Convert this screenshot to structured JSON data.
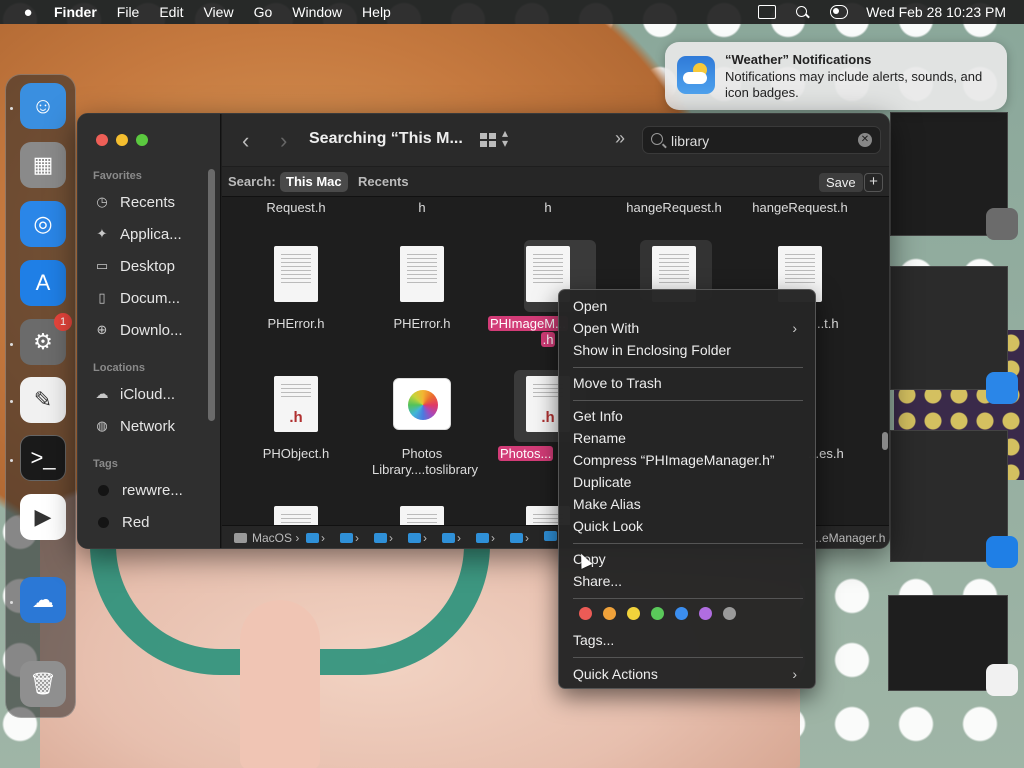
{
  "menubar": {
    "app": "Finder",
    "items": [
      "File",
      "Edit",
      "View",
      "Go",
      "Window",
      "Help"
    ],
    "datetime": "Wed Feb 28  10:23 PM"
  },
  "dock": {
    "apps": [
      {
        "name": "finder-icon",
        "color": "#3a8fe0",
        "glyph": "☺"
      },
      {
        "name": "launchpad-icon",
        "color": "#8a8a8a",
        "glyph": "▦"
      },
      {
        "name": "safari-icon",
        "color": "#2a86e8",
        "glyph": "◎"
      },
      {
        "name": "app-store-icon",
        "color": "#1f7fe6",
        "glyph": "A"
      },
      {
        "name": "system-settings-icon",
        "color": "#6b6b6b",
        "glyph": "⚙",
        "badge": "1"
      },
      {
        "name": "textedit-icon",
        "color": "#f1f1f1",
        "glyph": "✎"
      },
      {
        "name": "terminal-icon",
        "color": "#1a1a1a",
        "glyph": ">_"
      },
      {
        "name": "play-store-icon",
        "color": "#ffffff",
        "glyph": "▶"
      },
      {
        "name": "weather-icon",
        "color": "#2b78d6",
        "glyph": "☁"
      },
      {
        "name": "trash-icon",
        "color": "#8f8f8f",
        "glyph": "🗑"
      }
    ]
  },
  "notification": {
    "title": "“Weather” Notifications",
    "body": "Notifications may include alerts, sounds, and icon badges."
  },
  "finder": {
    "title": "Searching “This M...",
    "search_value": "library",
    "sidebar": {
      "favorites_header": "Favorites",
      "favorites": [
        "Recents",
        "Applica...",
        "Desktop",
        "Docum...",
        "Downlo..."
      ],
      "locations_header": "Locations",
      "locations": [
        "iCloud...",
        "Network"
      ],
      "tags_header": "Tags",
      "tags": [
        {
          "label": "rewwre...",
          "color": "#1a1a1a"
        },
        {
          "label": "Red",
          "color": "#1a1a1a"
        }
      ]
    },
    "scope": {
      "label": "Search:",
      "this_mac": "This Mac",
      "recents": "Recents",
      "save": "Save",
      "plus": "+"
    },
    "top_row_labels": [
      "Request.h",
      "h",
      "h",
      "hangeRequest.h",
      "hangeRequest.h"
    ],
    "files_row1": [
      "PHError.h",
      "PHError.h",
      "PHImageM...",
      "",
      "...t.h"
    ],
    "selected_label_line2": ".h",
    "files_row2": [
      {
        "label": "PHObject.h",
        "ext": ".h"
      },
      {
        "label": "Photos Library....toslibrary",
        "ext": ""
      },
      {
        "label": "Photos...",
        "ext": ".h"
      },
      {
        "label": "",
        "ext": ""
      },
      {
        "label": "...es.h",
        "ext": ""
      }
    ],
    "pathbar": {
      "root": "MacOS",
      "tail": "...eManager.h"
    }
  },
  "context_menu": {
    "group1": [
      "Open",
      "Open With",
      "Show in Enclosing Folder"
    ],
    "group2": [
      "Move to Trash"
    ],
    "group3": [
      "Get Info",
      "Rename",
      "Compress “PHImageManager.h”",
      "Duplicate",
      "Make Alias",
      "Quick Look"
    ],
    "group4": [
      "Copy",
      "Share..."
    ],
    "tag_colors": [
      "#ec5b56",
      "#f0a23a",
      "#f2d33b",
      "#5ac85a",
      "#3b8ef0",
      "#b06de0",
      "#9a9a9a"
    ],
    "tags_item": "Tags...",
    "quick_actions": "Quick Actions"
  }
}
